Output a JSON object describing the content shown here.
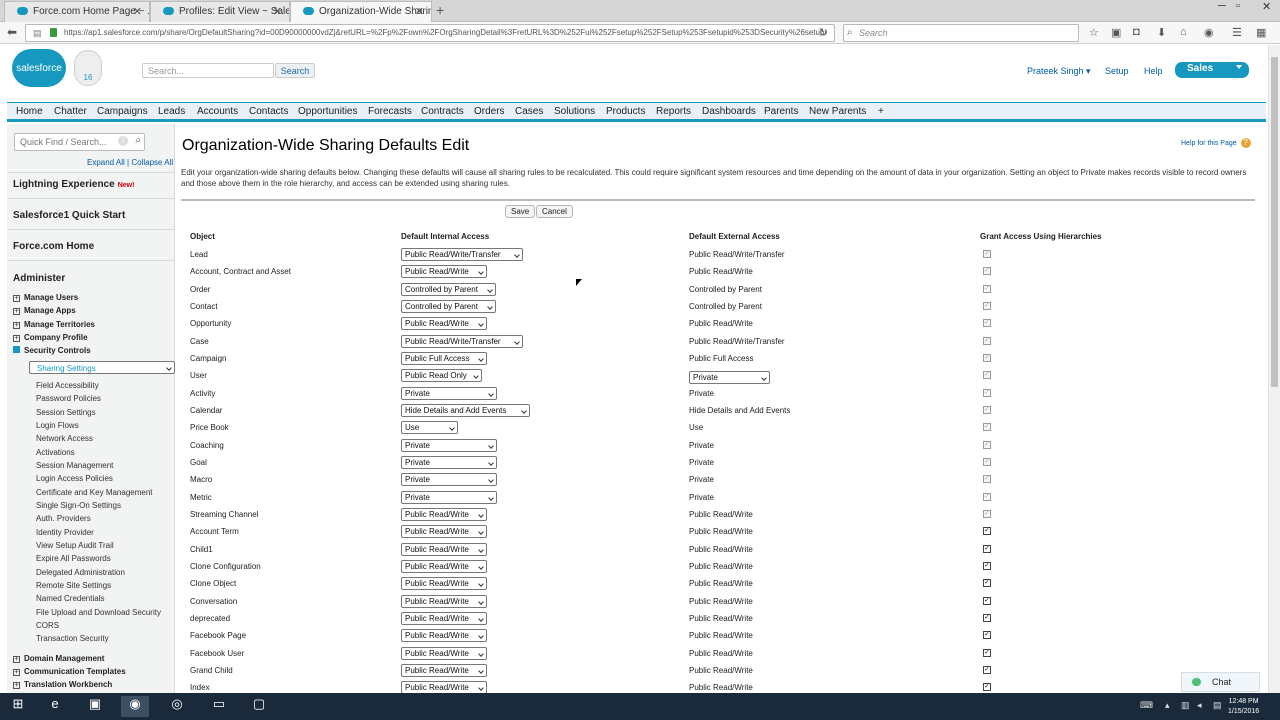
{
  "browser": {
    "tabs": [
      {
        "title": "Force.com Home Page ~ ..."
      },
      {
        "title": "Profiles: Edit View ~ Salesf..."
      },
      {
        "title": "Organization-Wide Sharin..."
      }
    ],
    "url": "https://ap1.salesforce.com/p/share/OrgDefaultSharing?id=00D90000000vdZj&retURL=%2Fp%2Fown%2FOrgSharingDetail%3FretURL%3D%252Fui%252Fsetup%252FSetup%253Fsetupid%253DSecurity%26setupi",
    "search_placeholder": "Search"
  },
  "header": {
    "logo_text": "salesforce",
    "badge_text": "16",
    "search_placeholder": "Search...",
    "search_button": "Search",
    "user_name": "Prateek Singh",
    "setup_link": "Setup",
    "help_link": "Help",
    "app_name": "Sales"
  },
  "tabs": [
    "Home",
    "Chatter",
    "Campaigns",
    "Leads",
    "Accounts",
    "Contacts",
    "Opportunities",
    "Forecasts",
    "Contracts",
    "Orders",
    "Cases",
    "Solutions",
    "Products",
    "Reports",
    "Dashboards",
    "Parents",
    "New Parents",
    "+"
  ],
  "sidebar": {
    "quick_find_placeholder": "Quick Find / Search...",
    "expand_all": "Expand All",
    "collapse_all": "Collapse All",
    "lightning": "Lightning Experience",
    "new_badge": "New!",
    "quick_start": "Salesforce1 Quick Start",
    "force_home": "Force.com Home",
    "administer": "Administer",
    "admin_items": [
      "Manage Users",
      "Manage Apps",
      "Manage Territories",
      "Company Profile",
      "Security Controls"
    ],
    "security_subitems": [
      "Sharing Settings",
      "Field Accessibility",
      "Password Policies",
      "Session Settings",
      "Login Flows",
      "Network Access",
      "Activations",
      "Session Management",
      "Login Access Policies",
      "Certificate and Key Management",
      "Single Sign-On Settings",
      "Auth. Providers",
      "Identity Provider",
      "View Setup Audit Trail",
      "Expire All Passwords",
      "Delegated Administration",
      "Remote Site Settings",
      "Named Credentials",
      "File Upload and Download Security",
      "CORS",
      "Transaction Security"
    ],
    "bottom_items": [
      "Domain Management",
      "Communication Templates",
      "Translation Workbench"
    ]
  },
  "page": {
    "title": "Organization-Wide Sharing Defaults Edit",
    "help_link": "Help for this Page",
    "description": "Edit your organization-wide sharing defaults below. Changing these defaults will cause all sharing rules to be recalculated. This could require significant system resources and time depending on the amount of data in your organization. Setting an object to Private makes records visible to record owners and those above them in the role hierarchy, and access can be extended using sharing rules.",
    "save": "Save",
    "cancel": "Cancel",
    "columns": {
      "object": "Object",
      "internal": "Default Internal Access",
      "external": "Default External Access",
      "hierarchy": "Grant Access Using Hierarchies"
    },
    "rows": [
      {
        "object": "Lead",
        "internal": "Public Read/Write/Transfer",
        "external": "Public Read/Write/Transfer",
        "checked": true,
        "disabled": true
      },
      {
        "object": "Account, Contract and Asset",
        "internal": "Public Read/Write",
        "external": "Public Read/Write",
        "checked": true,
        "disabled": true
      },
      {
        "object": "Order",
        "internal": "Controlled by Parent",
        "external": "Controlled by Parent",
        "checked": true,
        "disabled": true
      },
      {
        "object": "Contact",
        "internal": "Controlled by Parent",
        "external": "Controlled by Parent",
        "checked": true,
        "disabled": true
      },
      {
        "object": "Opportunity",
        "internal": "Public Read/Write",
        "external": "Public Read/Write",
        "checked": true,
        "disabled": true
      },
      {
        "object": "Case",
        "internal": "Public Read/Write/Transfer",
        "external": "Public Read/Write/Transfer",
        "checked": true,
        "disabled": true
      },
      {
        "object": "Campaign",
        "internal": "Public Full Access",
        "external": "Public Full Access",
        "checked": true,
        "disabled": true
      },
      {
        "object": "User",
        "internal": "Public Read Only",
        "external": "Private",
        "external_select": true,
        "checked": true,
        "disabled": true
      },
      {
        "object": "Activity",
        "internal": "Private",
        "external": "Private",
        "checked": true,
        "disabled": true
      },
      {
        "object": "Calendar",
        "internal": "Hide Details and Add Events",
        "external": "Hide Details and Add Events",
        "checked": true,
        "disabled": true
      },
      {
        "object": "Price Book",
        "internal": "Use",
        "external": "Use",
        "checked": true,
        "disabled": true
      },
      {
        "object": "Coaching",
        "internal": "Private",
        "external": "Private",
        "checked": true,
        "disabled": true
      },
      {
        "object": "Goal",
        "internal": "Private",
        "external": "Private",
        "checked": true,
        "disabled": true
      },
      {
        "object": "Macro",
        "internal": "Private",
        "external": "Private",
        "checked": true,
        "disabled": true
      },
      {
        "object": "Metric",
        "internal": "Private",
        "external": "Private",
        "checked": true,
        "disabled": true
      },
      {
        "object": "Streaming Channel",
        "internal": "Public Read/Write",
        "external": "Public Read/Write",
        "checked": true,
        "disabled": true
      },
      {
        "object": "Account Term",
        "internal": "Public Read/Write",
        "external": "Public Read/Write",
        "checked": true,
        "disabled": false
      },
      {
        "object": "Child1",
        "internal": "Public Read/Write",
        "external": "Public Read/Write",
        "checked": true,
        "disabled": false
      },
      {
        "object": "Clone Configuration",
        "internal": "Public Read/Write",
        "external": "Public Read/Write",
        "checked": true,
        "disabled": false
      },
      {
        "object": "Clone Object",
        "internal": "Public Read/Write",
        "external": "Public Read/Write",
        "checked": true,
        "disabled": false
      },
      {
        "object": "Conversation",
        "internal": "Public Read/Write",
        "external": "Public Read/Write",
        "checked": true,
        "disabled": false
      },
      {
        "object": "deprecated",
        "internal": "Public Read/Write",
        "external": "Public Read/Write",
        "checked": true,
        "disabled": false
      },
      {
        "object": "Facebook Page",
        "internal": "Public Read/Write",
        "external": "Public Read/Write",
        "checked": true,
        "disabled": false
      },
      {
        "object": "Facebook User",
        "internal": "Public Read/Write",
        "external": "Public Read/Write",
        "checked": true,
        "disabled": false
      },
      {
        "object": "Grand Child",
        "internal": "Public Read/Write",
        "external": "Public Read/Write",
        "checked": true,
        "disabled": false
      },
      {
        "object": "Index",
        "internal": "Public Read/Write",
        "external": "Public Read/Write",
        "checked": true,
        "disabled": false
      }
    ]
  },
  "chat": {
    "label": "Chat"
  },
  "taskbar": {
    "time": "12:48 PM",
    "date": "1/15/2016"
  }
}
